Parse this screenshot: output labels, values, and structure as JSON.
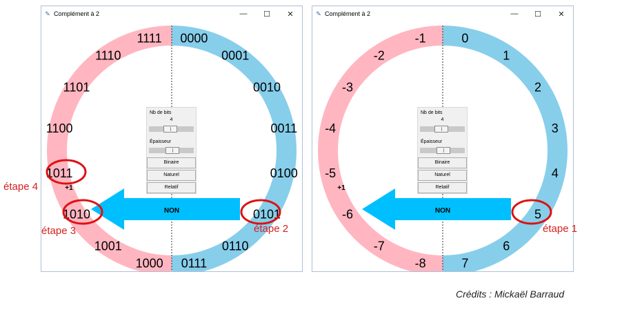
{
  "windows": [
    {
      "title": "Complément à 2",
      "controls": {
        "minimize": "—",
        "maximize": "☐",
        "close": "✕"
      },
      "panel": {
        "nb_bits_label": "Nb de bits",
        "nb_bits_value": "4",
        "epaisseur_label": "Épaisseur",
        "buttons": [
          "Binaire",
          "Naturel",
          "Relatif"
        ]
      },
      "ring_labels": [
        "0000",
        "0001",
        "0010",
        "0011",
        "0100",
        "0101",
        "0110",
        "0111",
        "1000",
        "1001",
        "1010",
        "1011",
        "1100",
        "1101",
        "1110",
        "1111"
      ],
      "arrow_label": "NON",
      "plus_one": "+1"
    },
    {
      "title": "Complément à 2",
      "controls": {
        "minimize": "—",
        "maximize": "☐",
        "close": "✕"
      },
      "panel": {
        "nb_bits_label": "Nb de bits",
        "nb_bits_value": "4",
        "epaisseur_label": "Épaisseur",
        "buttons": [
          "Binaire",
          "Naturel",
          "Relatif"
        ]
      },
      "ring_labels": [
        "0",
        "1",
        "2",
        "3",
        "4",
        "5",
        "6",
        "7",
        "-8",
        "-7",
        "-6",
        "-5",
        "-4",
        "-3",
        "-2",
        "-1"
      ],
      "arrow_label": "NON",
      "plus_one": "+1"
    }
  ],
  "annotations": {
    "etape1": "étape 1",
    "etape2": "étape 2",
    "etape3": "étape 3",
    "etape4": "étape 4"
  },
  "credits": "Crédits : Mickaël Barraud",
  "colors": {
    "positive": "#87ceeb",
    "negative": "#ffb6c1",
    "arrow": "#00bfff",
    "highlight": "#dd1111"
  }
}
